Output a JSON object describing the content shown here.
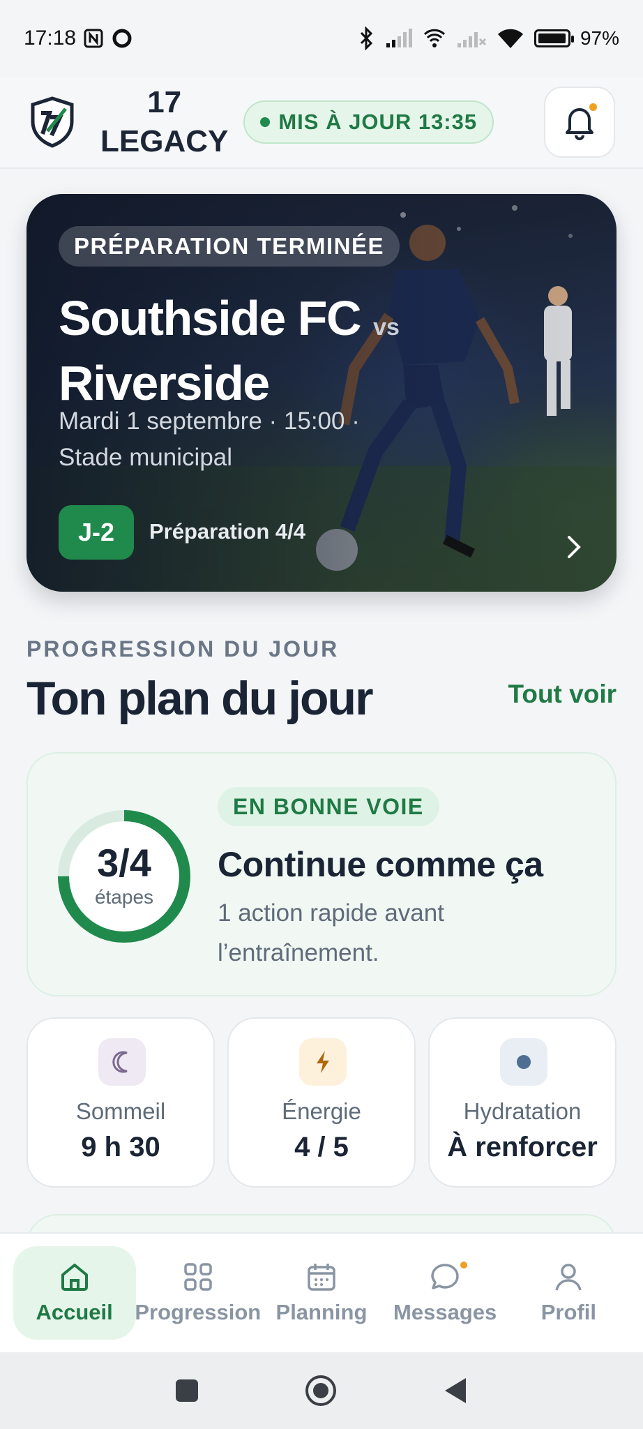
{
  "status_bar": {
    "time": "17:18",
    "battery": "97%",
    "battery_level": 0.97
  },
  "header": {
    "brand_line1": "17",
    "brand_line2": "LEGACY",
    "updated_label": "MIS À JOUR 13:35"
  },
  "hero": {
    "badge": "PRÉPARATION TERMINÉE",
    "team_home": "Southside FC",
    "vs": "vs",
    "team_away": "Riverside",
    "datetime": "Mardi 1 septembre · 15:00 ·",
    "venue": "Stade municipal",
    "countdown": "J-2",
    "preparation": "Préparation 4/4"
  },
  "section": {
    "eyebrow": "PROGRESSION DU JOUR",
    "title": "Ton plan du jour",
    "see_all": "Tout voir"
  },
  "progress": {
    "value": "3/4",
    "unit": "étapes",
    "fraction": 0.75,
    "status": "EN BONNE VOIE",
    "title": "Continue comme ça",
    "message": "1 action rapide avant l’entraînement."
  },
  "stats": [
    {
      "icon": "moon-icon",
      "label": "Sommeil",
      "value": "9 h 30",
      "icon_bg": "#efe9f3",
      "icon_color": "#7b6a8f"
    },
    {
      "icon": "lightning-icon",
      "label": "Énergie",
      "value": "4 / 5",
      "icon_bg": "#fdf1dc",
      "icon_color": "#b0660c"
    },
    {
      "icon": "water-drop-icon",
      "label": "Hydratation",
      "value": "À renforcer",
      "icon_bg": "#e8eef4",
      "icon_color": "#4e6f92"
    }
  ],
  "nav": [
    {
      "label": "Accueil",
      "icon": "home-icon",
      "active": true
    },
    {
      "label": "Progression",
      "icon": "grid-icon",
      "active": false
    },
    {
      "label": "Planning",
      "icon": "calendar-icon",
      "active": false
    },
    {
      "label": "Messages",
      "icon": "chat-icon",
      "active": false,
      "notification": true
    },
    {
      "label": "Profil",
      "icon": "person-icon",
      "active": false
    }
  ],
  "colors": {
    "accent": "#1f8a4c",
    "accent_text": "#1f7a45",
    "notification": "#f0a020",
    "text_primary": "#1a2435",
    "text_muted": "#5f6b79"
  }
}
